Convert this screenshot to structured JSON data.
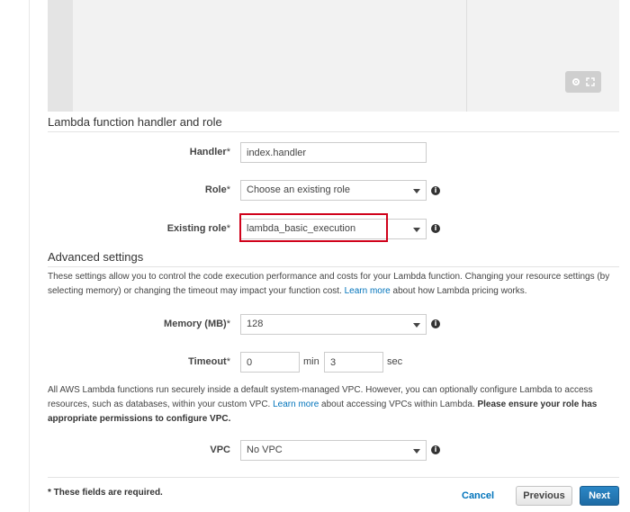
{
  "handler_role": {
    "title": "Lambda function handler and role",
    "handler_label": "Handler",
    "handler_value": "index.handler",
    "role_label": "Role",
    "role_value": "Choose an existing role",
    "existing_role_label": "Existing role",
    "existing_role_value": "lambda_basic_execution",
    "required_mark": "*"
  },
  "advanced": {
    "title": "Advanced settings",
    "desc_part1": "These settings allow you to control the code execution performance and costs for your Lambda function. Changing your resource settings (by selecting memory) or changing the timeout may impact your function cost. ",
    "desc_link": "Learn more",
    "desc_part2": " about how Lambda pricing works.",
    "memory_label": "Memory (MB)",
    "memory_value": "128",
    "timeout_label": "Timeout",
    "timeout_min_value": "0",
    "timeout_min_unit": "min",
    "timeout_sec_value": "3",
    "timeout_sec_unit": "sec",
    "vpc_desc_part1": "All AWS Lambda functions run securely inside a default system-managed VPC. However, you can optionally configure Lambda to access resources, such as databases, within your custom VPC. ",
    "vpc_desc_link": "Learn more",
    "vpc_desc_part2": " about accessing VPCs within Lambda. ",
    "vpc_desc_bold": "Please ensure your role has appropriate permissions to configure VPC.",
    "vpc_label": "VPC",
    "vpc_value": "No VPC"
  },
  "footer": {
    "required_note": "* These fields are required.",
    "cancel_label": "Cancel",
    "previous_label": "Previous",
    "next_label": "Next"
  },
  "icons": {
    "info": "info-icon",
    "settings": "gear-icon",
    "fullscreen": "expand-icon",
    "dropdown": "caret-down-icon"
  },
  "colors": {
    "link": "#0073bb",
    "primary_button": "#2b87c6",
    "highlight": "#d0021b"
  }
}
